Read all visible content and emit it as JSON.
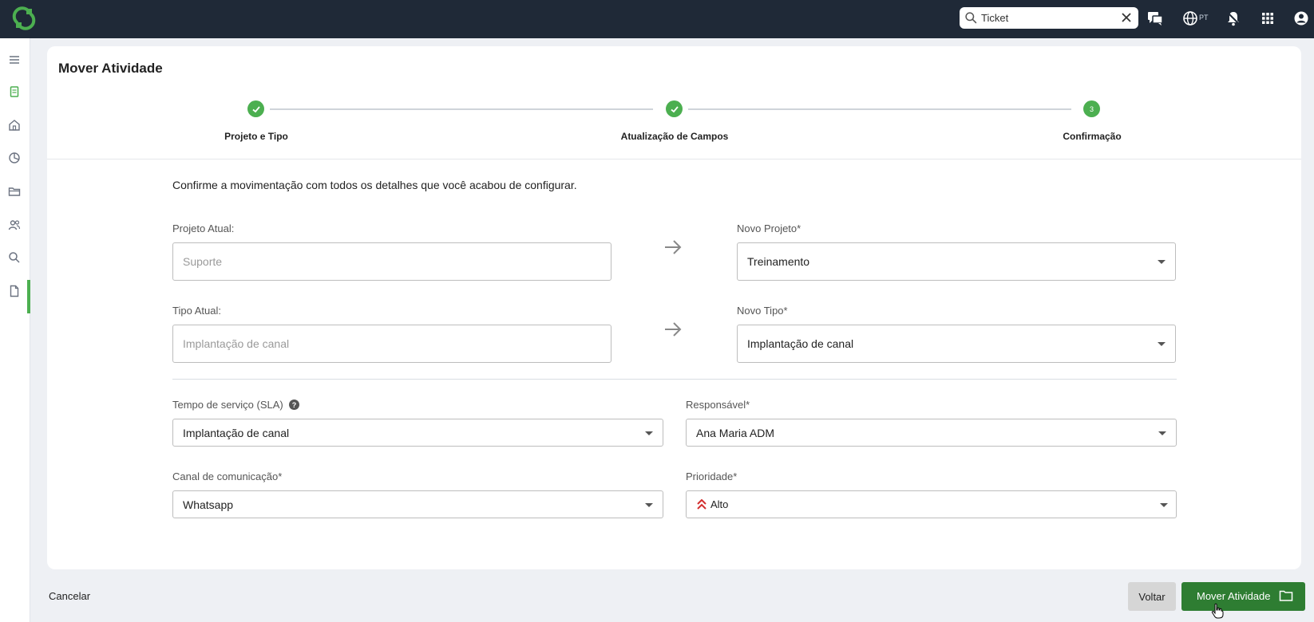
{
  "header": {
    "logo_icon": "app-logo-icon",
    "search": {
      "value": "Ticket",
      "placeholder": ""
    },
    "language": "PT",
    "icons": [
      "chat-icon",
      "globe-icon",
      "notification-bell-icon",
      "apps-grid-icon",
      "user-account-icon"
    ]
  },
  "sidebar": {
    "items": [
      "menu-icon",
      "ticket-icon",
      "home-icon",
      "chart-icon",
      "folder-icon",
      "users-icon",
      "search-icon",
      "document-icon"
    ],
    "active": "search-icon"
  },
  "page": {
    "title": "Mover Atividade"
  },
  "stepper": {
    "steps": [
      {
        "label": "Projeto e Tipo",
        "status": "done"
      },
      {
        "label": "Atualização de Campos",
        "status": "done"
      },
      {
        "label": "Confirmação",
        "number": "3",
        "status": "current"
      }
    ]
  },
  "form": {
    "intro": "Confirme a movimentação com todos os detalhes que você acabou de configurar.",
    "current_project": {
      "label": "Projeto Atual:",
      "value": "Suporte"
    },
    "new_project": {
      "label": "Novo Projeto*",
      "value": "Treinamento"
    },
    "current_type": {
      "label": "Tipo Atual:",
      "value": "Implantação de canal"
    },
    "new_type": {
      "label": "Novo Tipo*",
      "value": "Implantação de canal"
    },
    "sla": {
      "label": "Tempo de serviço (SLA)",
      "help": "?",
      "value": "Implantação de canal"
    },
    "responsible": {
      "label": "Responsável*",
      "value": "Ana Maria ADM"
    },
    "channel": {
      "label": "Canal de comunicação*",
      "value": "Whatsapp"
    },
    "priority": {
      "label": "Prioridade*",
      "value": "Alto",
      "icon": "priority-high-icon",
      "color": "#d32f2f"
    }
  },
  "footer": {
    "cancel_label": "Cancelar",
    "back_label": "Voltar",
    "move_label": "Mover Atividade"
  },
  "colors": {
    "accent": "#4caf50",
    "primary_button": "#2e7d32",
    "topbar": "#1f2937"
  }
}
